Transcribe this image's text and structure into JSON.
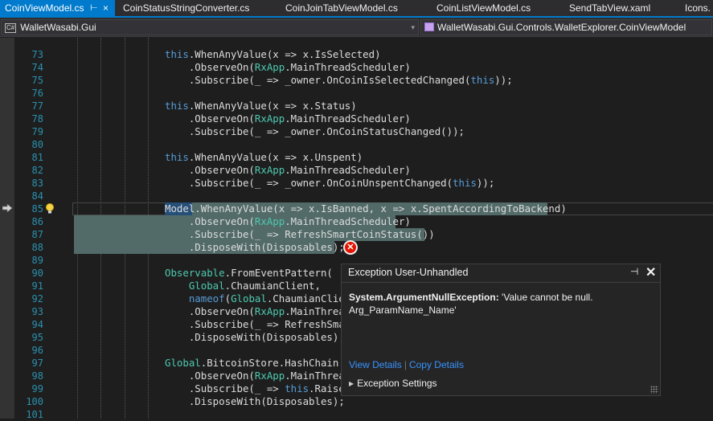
{
  "tabs": [
    {
      "label": "CoinViewModel.cs",
      "active": true
    },
    {
      "label": "CoinStatusStringConverter.cs"
    },
    {
      "label": "CoinJoinTabViewModel.cs"
    },
    {
      "label": "CoinListViewModel.cs"
    },
    {
      "label": "SendTabView.xaml"
    },
    {
      "label": "Icons."
    }
  ],
  "icons": {
    "pin": "⊢",
    "close": "×",
    "dropdown": "▾"
  },
  "nav": {
    "project_badge": "C#",
    "project": "WalletWasabi.Gui",
    "member": "WalletWasabi.Gui.Controls.WalletExplorer.CoinViewModel"
  },
  "lines": [
    {
      "n": "73",
      "html": "<span class=\"kw\">this</span>.WhenAnyValue(x =&gt; x.IsSelected)"
    },
    {
      "n": "74",
      "html": "    .ObserveOn(<span class=\"ty\">RxApp</span>.MainThreadScheduler)"
    },
    {
      "n": "75",
      "html": "    .Subscribe(_ =&gt; _owner.OnCoinIsSelectedChanged(<span class=\"kw\">this</span>));"
    },
    {
      "n": "76",
      "html": ""
    },
    {
      "n": "77",
      "html": "<span class=\"kw\">this</span>.WhenAnyValue(x =&gt; x.Status)"
    },
    {
      "n": "78",
      "html": "    .ObserveOn(<span class=\"ty\">RxApp</span>.MainThreadScheduler)"
    },
    {
      "n": "79",
      "html": "    .Subscribe(_ =&gt; _owner.OnCoinStatusChanged());"
    },
    {
      "n": "80",
      "html": ""
    },
    {
      "n": "81",
      "html": "<span class=\"kw\">this</span>.WhenAnyValue(x =&gt; x.Unspent)"
    },
    {
      "n": "82",
      "html": "    .ObserveOn(<span class=\"ty\">RxApp</span>.MainThreadScheduler)"
    },
    {
      "n": "83",
      "html": "    .Subscribe(_ =&gt; _owner.OnCoinUnspentChanged(<span class=\"kw\">this</span>));"
    },
    {
      "n": "84",
      "html": ""
    },
    {
      "n": "85",
      "html": "Model.WhenAnyValue(x =&gt; x.IsBanned, x =&gt; x.SpentAccordingToBackend)"
    },
    {
      "n": "86",
      "html": "    .ObserveOn(<span class=\"ty\">RxApp</span>.MainThreadScheduler)"
    },
    {
      "n": "87",
      "html": "    .Subscribe(_ =&gt; RefreshSmartCoinStatus())"
    },
    {
      "n": "88",
      "html": "    .DisposeWith(Disposables);"
    },
    {
      "n": "89",
      "html": ""
    },
    {
      "n": "90",
      "html": "<span class=\"ty\">Observable</span>.FromEventPattern("
    },
    {
      "n": "91",
      "html": "    <span class=\"ty\">Global</span>.ChaumianClient,"
    },
    {
      "n": "92",
      "html": "    <span class=\"kw\">nameof</span>(<span class=\"ty\">Global</span>.ChaumianClient"
    },
    {
      "n": "93",
      "html": "    .ObserveOn(<span class=\"ty\">RxApp</span>.MainThread"
    },
    {
      "n": "94",
      "html": "    .Subscribe(_ =&gt; RefreshSmar"
    },
    {
      "n": "95",
      "html": "    .DisposeWith(Disposables);"
    },
    {
      "n": "96",
      "html": ""
    },
    {
      "n": "97",
      "html": "<span class=\"ty\">Global</span>.BitcoinStore.HashChain.W"
    },
    {
      "n": "98",
      "html": "    .ObserveOn(<span class=\"ty\">RxApp</span>.MainThread"
    },
    {
      "n": "99",
      "html": "    .Subscribe(_ =&gt; <span class=\"kw\">this</span>.RaiseP"
    },
    {
      "n": "100",
      "html": "    .DisposeWith(Disposables);"
    },
    {
      "n": "101",
      "html": ""
    }
  ],
  "exception": {
    "title": "Exception User-Unhandled",
    "type": "System.ArgumentNullException:",
    "message": "'Value cannot be null.",
    "message2": "Arg_ParamName_Name'",
    "view_details": "View Details",
    "separator": "|",
    "copy_details": "Copy Details",
    "settings": "Exception Settings",
    "pin_icon": "⊣",
    "close_icon": "✕",
    "expander_icon": "▶",
    "error_badge_icon": "✕"
  },
  "colors": {
    "accent": "#007acc",
    "keyword": "#569cd6",
    "type": "#4ec9b0",
    "line_number": "#2b91af",
    "exception_highlight": "#526b68",
    "error": "#e51400",
    "link": "#3794ff"
  }
}
